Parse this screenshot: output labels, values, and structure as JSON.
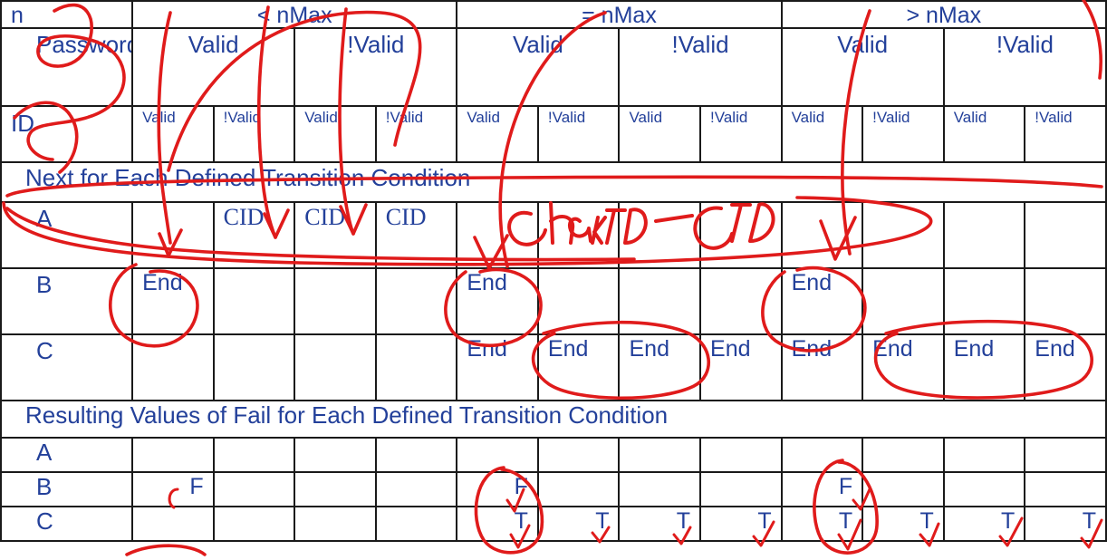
{
  "table": {
    "columns": 12,
    "label_column_header_rows": [
      "n",
      "Password",
      "ID"
    ],
    "text_color": "#23409a",
    "grid_color": "#1a1a1a",
    "annotation_color": "#e01b1b",
    "n_groups": [
      "< nMax",
      "= nMax",
      "> nMax"
    ],
    "password_groups": [
      "Valid",
      "!Valid",
      "Valid",
      "!Valid",
      "Valid",
      "!Valid"
    ],
    "id_row": [
      "Valid",
      "!Valid",
      "Valid",
      "!Valid",
      "Valid",
      "!Valid",
      "Valid",
      "!Valid",
      "Valid",
      "!Valid",
      "Valid",
      "!Valid"
    ],
    "section1_title": "Next for Each Defined Transition Condition",
    "section1_rows": [
      {
        "label": "A",
        "values": [
          "",
          "CID",
          "CID",
          "CID",
          "",
          "",
          "",
          "",
          "",
          "",
          "",
          ""
        ]
      },
      {
        "label": "B",
        "values": [
          "End",
          "",
          "",
          "",
          "End",
          "",
          "",
          "",
          "End",
          "",
          "",
          ""
        ]
      },
      {
        "label": "C",
        "values": [
          "",
          "",
          "",
          "",
          "End",
          "End",
          "End",
          "End",
          "End",
          "End",
          "End",
          "End"
        ]
      }
    ],
    "section2_title": "Resulting Values of Fail for Each Defined Transition Condition",
    "section2_rows": [
      {
        "label": "A",
        "values": [
          "",
          "",
          "",
          "",
          "",
          "",
          "",
          "",
          "",
          "",
          "",
          ""
        ]
      },
      {
        "label": "B",
        "values": [
          "F",
          "",
          "",
          "",
          "F",
          "",
          "",
          "",
          "F",
          "",
          "",
          ""
        ]
      },
      {
        "label": "C",
        "values": [
          "",
          "",
          "",
          "",
          "T",
          "T",
          "T",
          "T",
          "T",
          "T",
          "T",
          "T"
        ]
      }
    ]
  },
  "annotations": {
    "handwritten_notes": [
      {
        "name": "check-id-note",
        "text": "CheckID  —  CID"
      }
    ],
    "marks": [
      "circle-around-n-password-id-labels",
      "arrow-into-B-lt-nMax-End",
      "circle-around-B-lt-nMax-End",
      "arrow-into-B-eq-nMax-End",
      "circle-around-B-eq-nMax-End",
      "arrow-into-B-gt-nMax-End",
      "circle-around-B-gt-nMax-End",
      "oval-around-row-A",
      "strikethrough-section1-title",
      "oval-around-C-eq-nMax-End-group",
      "oval-around-C-gt-nMax-End-group",
      "circle-around-B-C-eq-nMax-F-T",
      "circle-around-B-C-gt-nMax-F-T",
      "check-marks-on-T-and-F-values",
      "vertical-strokes-through-header-columns"
    ]
  }
}
